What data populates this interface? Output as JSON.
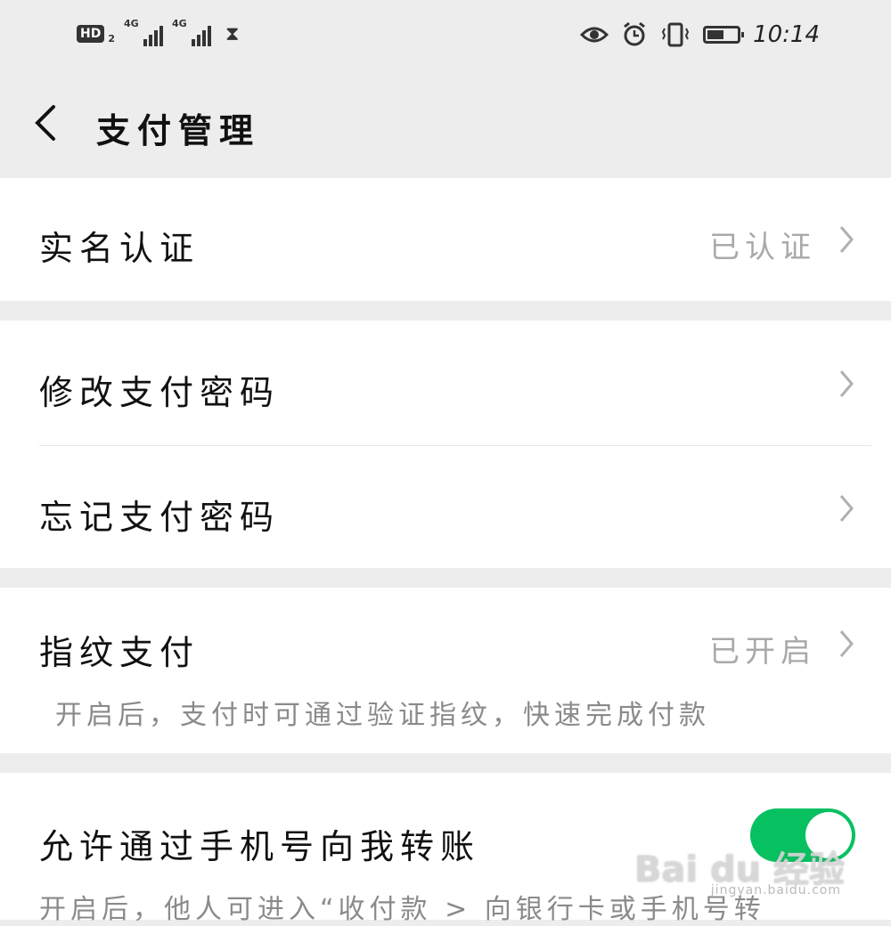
{
  "status_bar": {
    "hd_label": "HD",
    "hd_sub": "2",
    "signal1_label": "4G",
    "signal2_label": "4G",
    "hourglass": "⧗",
    "time": "10:14",
    "icons": [
      "eye-comfort-icon",
      "alarm-icon",
      "vibrate-icon",
      "battery-icon"
    ]
  },
  "nav": {
    "back_icon": "chevron-left-icon",
    "title": "支付管理"
  },
  "sections": {
    "real_name": {
      "label": "实名认证",
      "value": "已认证"
    },
    "change_password": {
      "label": "修改支付密码"
    },
    "forget_password": {
      "label": "忘记支付密码"
    },
    "fingerprint": {
      "label": "指纹支付",
      "value": "已开启",
      "description": "开启后，支付时可通过验证指纹，快速完成付款"
    },
    "phone_transfer": {
      "label": "允许通过手机号向我转账",
      "toggle_on": true,
      "description": "开启后，他人可进入“收付款 > 向银行卡或手机号转"
    }
  },
  "watermark": {
    "main": "Bai du 经验",
    "sub": "jingyan.baidu.com"
  },
  "colors": {
    "accent": "#07c160",
    "background": "#ededed",
    "card": "#ffffff",
    "muted": "#a9a9a9"
  }
}
